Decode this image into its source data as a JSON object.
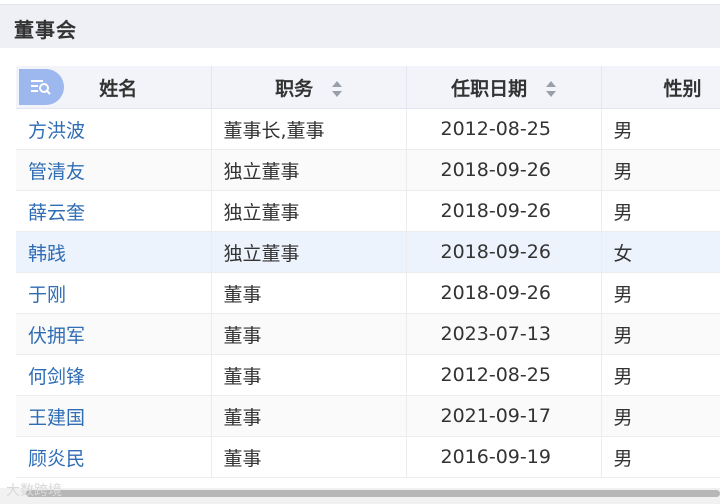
{
  "section": {
    "title": "董事会"
  },
  "table": {
    "headers": {
      "name": "姓名",
      "position": "职务",
      "date": "任职日期",
      "gender": "性别"
    },
    "rows": [
      {
        "name": "方洪波",
        "position": "董事长,董事",
        "date": "2012-08-25",
        "gender": "男"
      },
      {
        "name": "管清友",
        "position": "独立董事",
        "date": "2018-09-26",
        "gender": "男"
      },
      {
        "name": "薛云奎",
        "position": "独立董事",
        "date": "2018-09-26",
        "gender": "男"
      },
      {
        "name": "韩践",
        "position": "独立董事",
        "date": "2018-09-26",
        "gender": "女"
      },
      {
        "name": "于刚",
        "position": "董事",
        "date": "2018-09-26",
        "gender": "男"
      },
      {
        "name": "伏拥军",
        "position": "董事",
        "date": "2023-07-13",
        "gender": "男"
      },
      {
        "name": "何剑锋",
        "position": "董事",
        "date": "2012-08-25",
        "gender": "男"
      },
      {
        "name": "王建国",
        "position": "董事",
        "date": "2021-09-17",
        "gender": "男"
      },
      {
        "name": "顾炎民",
        "position": "董事",
        "date": "2016-09-19",
        "gender": "男"
      }
    ]
  },
  "icons": {
    "filter": "filter-search-icon",
    "sort": "sort-icon"
  },
  "colors": {
    "link": "#2f6db5",
    "header_bg": "#f2f4f9",
    "highlight_row": "#edf3fd",
    "filter_button": "#9cb8ee"
  },
  "watermark": {
    "text": "大数跨境"
  }
}
